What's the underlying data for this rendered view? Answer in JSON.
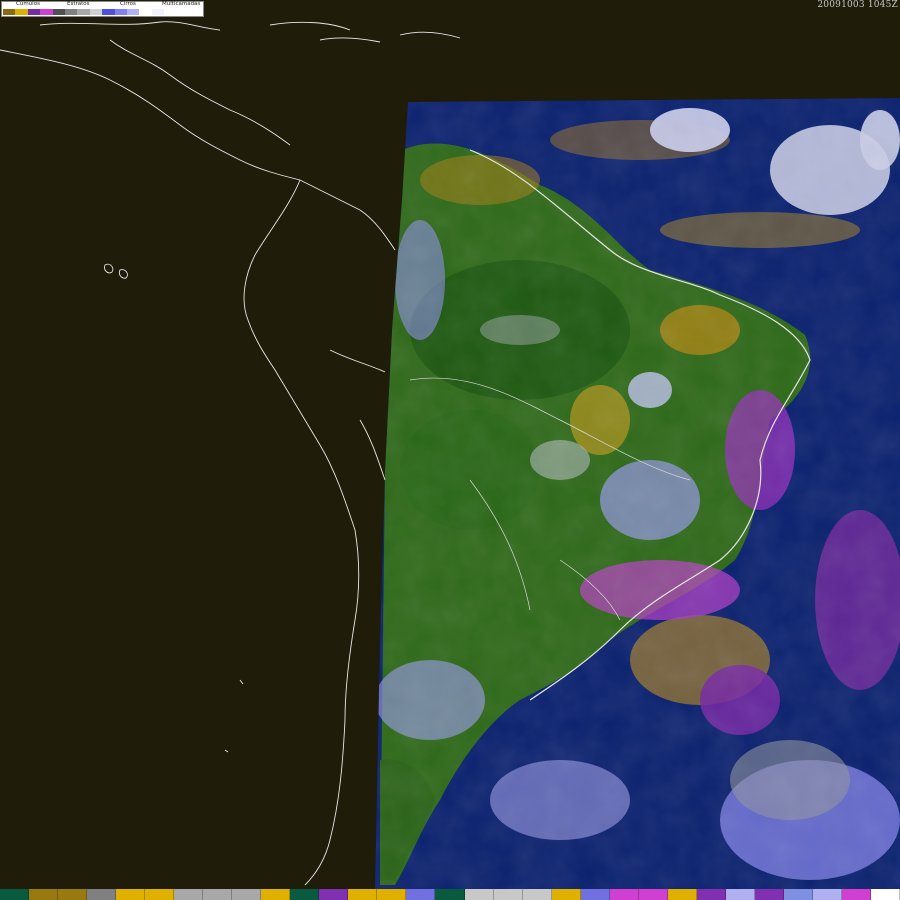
{
  "legend": {
    "labels": {
      "cumulos": "Cúmulos",
      "estratos": "Estratos",
      "cirros": "Cirros",
      "multicamadas": "Multicamadas"
    },
    "swatches": [
      "#8a6a10",
      "#e0b000",
      "#7a2aa0",
      "#d040d0",
      "#505050",
      "#808080",
      "#a8a8a8",
      "#d0d0d0",
      "#5050e0",
      "#8080f0",
      "#b0b0f8",
      "#ffffff",
      "#f0f0ff"
    ]
  },
  "timestamp": "20091003 1045Z",
  "bottom_strip": [
    "#0a5a40",
    "#9a7a10",
    "#9a7a10",
    "#808080",
    "#e0b000",
    "#e0b000",
    "#a8a8a8",
    "#a8a8a8",
    "#a8a8a8",
    "#e0b000",
    "#0a5a40",
    "#8030b0",
    "#e0b000",
    "#e0b000",
    "#7070e0",
    "#0a5a40",
    "#c8c8c8",
    "#c8c8c8",
    "#c8c8c8",
    "#e0b000",
    "#7070e0",
    "#d040d0",
    "#d040d0",
    "#e0b000",
    "#8030b0",
    "#b0b0f0",
    "#8030b0",
    "#8090e0",
    "#b0b0f0",
    "#d040d0",
    "#ffffff"
  ],
  "colors": {
    "background": "#1f1c0a",
    "ocean": "#0b2270",
    "land": "#2f6a1a",
    "coastline": "#e8e8e8"
  }
}
